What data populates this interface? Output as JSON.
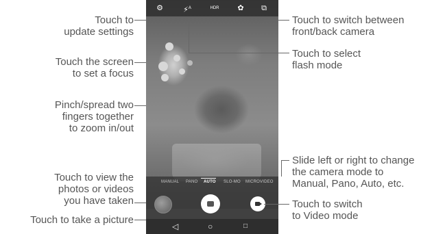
{
  "annotations": {
    "settings": [
      "Touch to",
      "update settings"
    ],
    "focus": [
      "Touch the screen",
      "to set a focus"
    ],
    "zoom": [
      "Pinch/spread two",
      "fingers together",
      "to zoom in/out"
    ],
    "view_photos": [
      "Touch to view the",
      "photos or videos",
      "you have taken"
    ],
    "take_picture": "Touch to take a picture",
    "switch_camera": [
      "Touch to switch between",
      "front/back camera"
    ],
    "flash": [
      "Touch to select",
      "flash mode"
    ],
    "camera_mode": [
      "Slide left or right to change",
      "the camera mode to",
      "Manual, Pano,  Auto, etc."
    ],
    "video_mode": [
      "Touch to switch",
      "to Video mode"
    ]
  },
  "camera": {
    "flash_label": "A",
    "hdr_label": "HDR",
    "modes": [
      "MANUAL",
      "PANO",
      "AUTO",
      "SLO-MO",
      "MICROVIDEO"
    ],
    "active_mode": "AUTO"
  },
  "icons": {
    "settings": "gear-icon",
    "flash": "flash-icon",
    "hdr": "hdr-icon",
    "filter": "filter-icon",
    "switch_camera": "switch-camera-icon",
    "shutter": "camera-icon",
    "video": "video-camera-icon",
    "back": "back-triangle-icon",
    "home": "home-circle-icon",
    "recents": "recents-square-icon"
  },
  "colors": {
    "annotation_text": "#555555",
    "leader_line": "#666666"
  }
}
